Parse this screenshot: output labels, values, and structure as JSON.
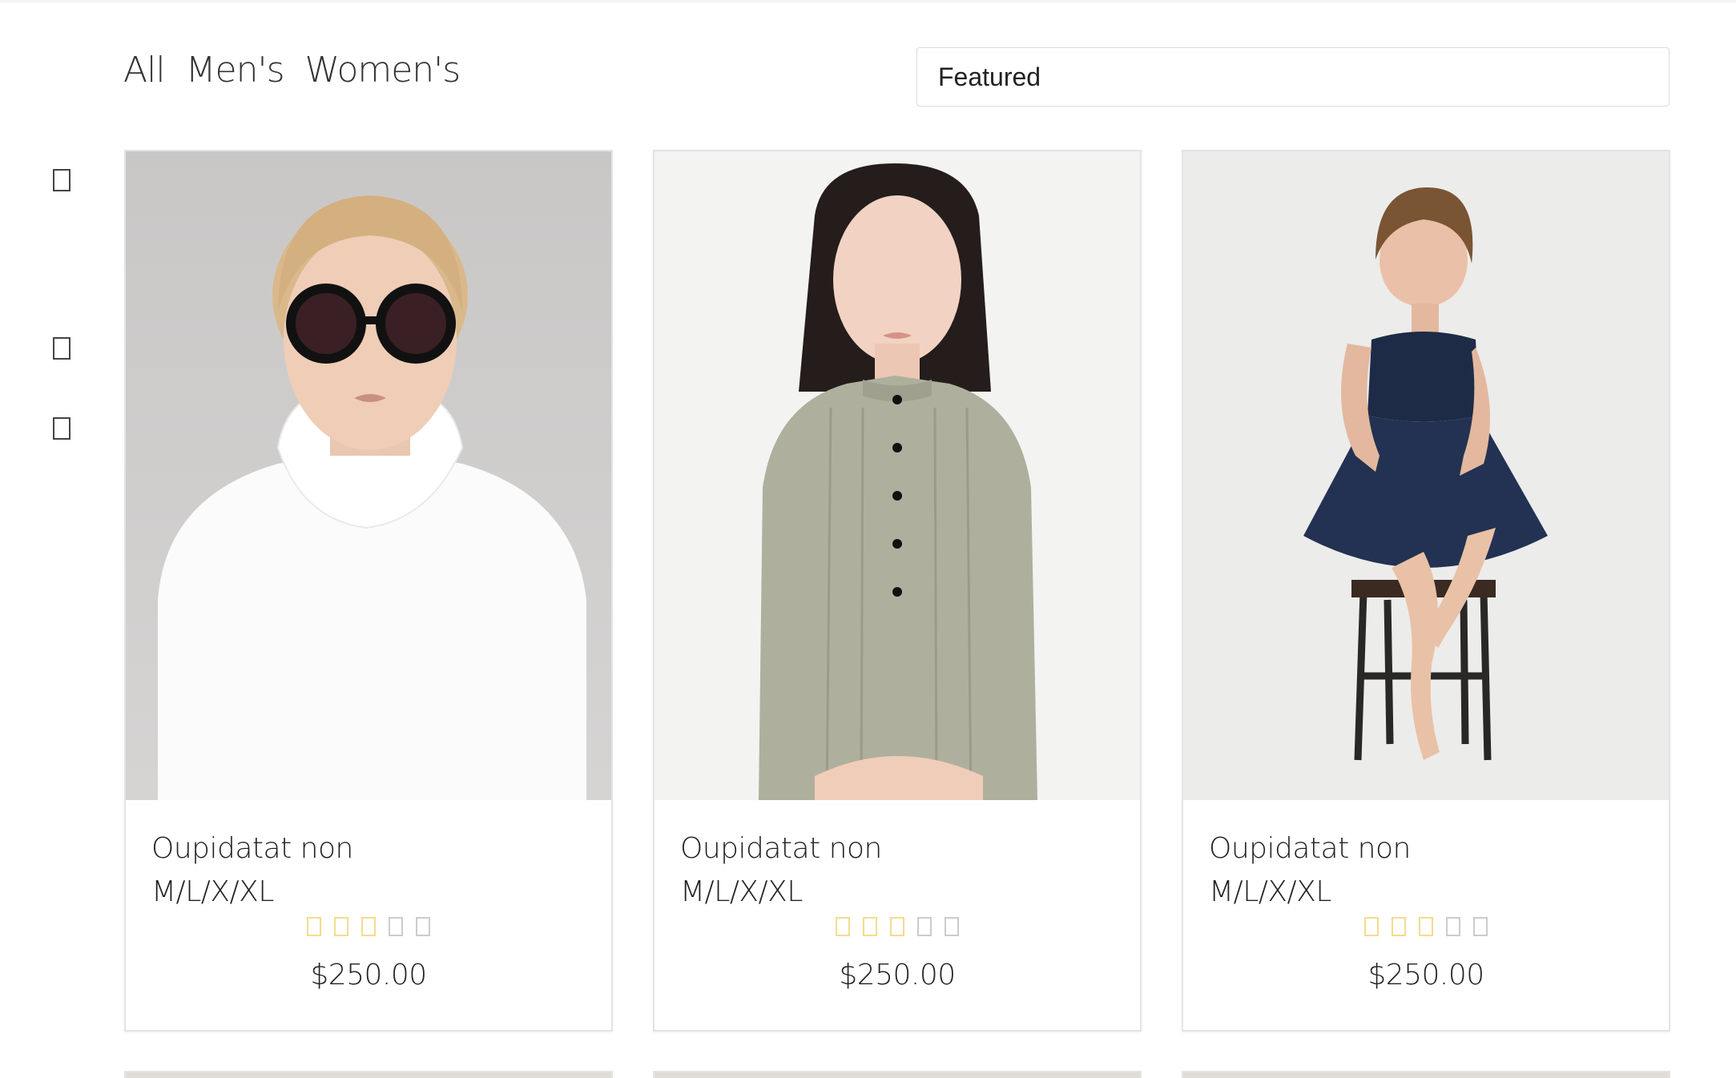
{
  "filters": [
    "All",
    "Men's",
    "Women's"
  ],
  "sort": {
    "selected": "Featured"
  },
  "side_icons": [
    "square-icon",
    "square-icon",
    "square-icon"
  ],
  "products": [
    {
      "name": "Oupidatat non",
      "sizes": "M/L/X/XL",
      "rating": 3,
      "max_rating": 5,
      "price": "$250.00",
      "image": "woman-white-turtleneck-sunglasses"
    },
    {
      "name": "Oupidatat non",
      "sizes": "M/L/X/XL",
      "rating": 3,
      "max_rating": 5,
      "price": "$250.00",
      "image": "woman-sage-linen-dress"
    },
    {
      "name": "Oupidatat non",
      "sizes": "M/L/X/XL",
      "rating": 3,
      "max_rating": 5,
      "price": "$250.00",
      "image": "woman-navy-dress-stool"
    }
  ],
  "colors": {
    "star_on": "#f3dc8e",
    "star_off": "#cccccc",
    "border": "#e4e4e4"
  }
}
